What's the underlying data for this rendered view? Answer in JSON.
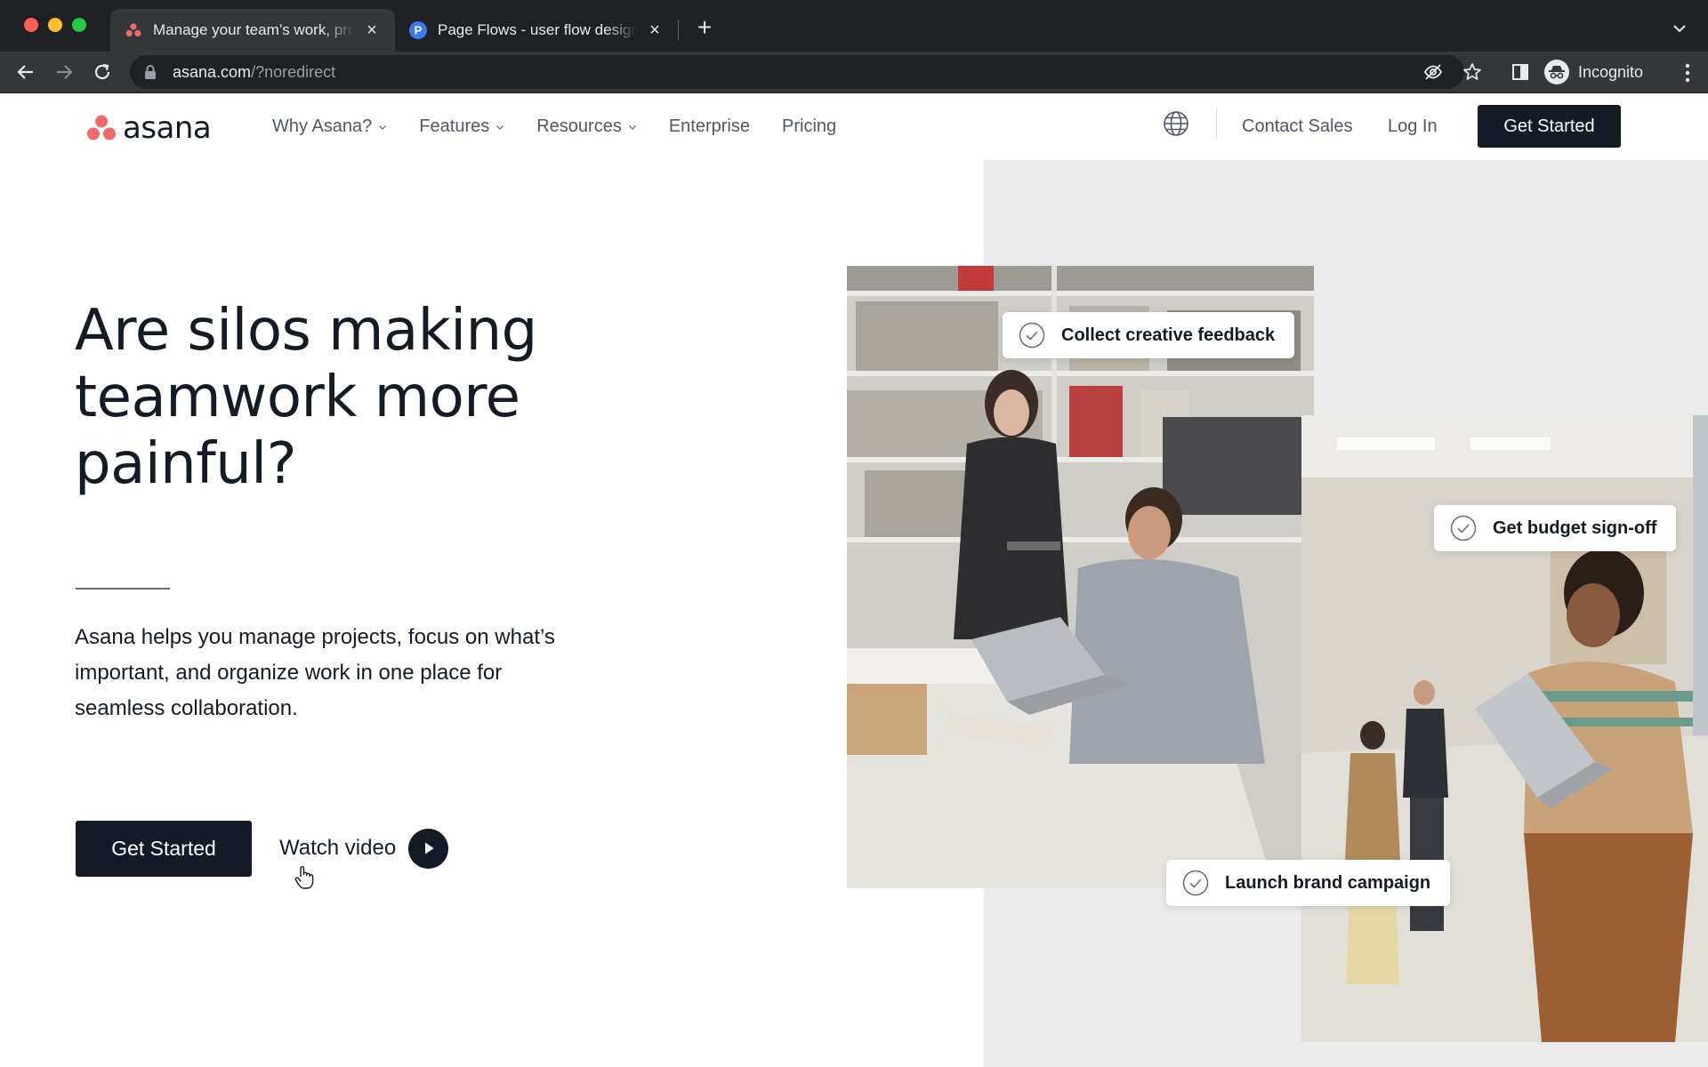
{
  "browser": {
    "tabs": [
      {
        "title": "Manage your team’s work, projects",
        "active": true,
        "favicon": "asana-favicon"
      },
      {
        "title": "Page Flows - user flow design",
        "active": false,
        "favicon": "page-flows-favicon",
        "favicon_letter": "P"
      }
    ],
    "new_tab": "+",
    "url": {
      "host": "asana.com",
      "path": "/?noredirect"
    },
    "profile_label": "Incognito"
  },
  "header": {
    "logo_text": "asana",
    "nav": [
      {
        "label": "Why Asana?",
        "dropdown": true
      },
      {
        "label": "Features",
        "dropdown": true
      },
      {
        "label": "Resources",
        "dropdown": true
      },
      {
        "label": "Enterprise",
        "dropdown": false
      },
      {
        "label": "Pricing",
        "dropdown": false
      }
    ],
    "contact_sales": "Contact Sales",
    "log_in": "Log In",
    "get_started": "Get Started"
  },
  "hero": {
    "title": "Are silos making teamwork more painful?",
    "body": "Asana helps you manage projects, focus on what’s important, and organize work in one place for seamless collaboration.",
    "cta": "Get Started",
    "watch_video": "Watch video"
  },
  "chips": {
    "c1": "Collect creative feedback",
    "c2": "Get budget sign-off",
    "c3": "Launch brand campaign"
  },
  "colors": {
    "brand_coral": "#f06a6a",
    "ink": "#151b26",
    "muted": "#505765",
    "hero_gray": "#ebeaea"
  }
}
